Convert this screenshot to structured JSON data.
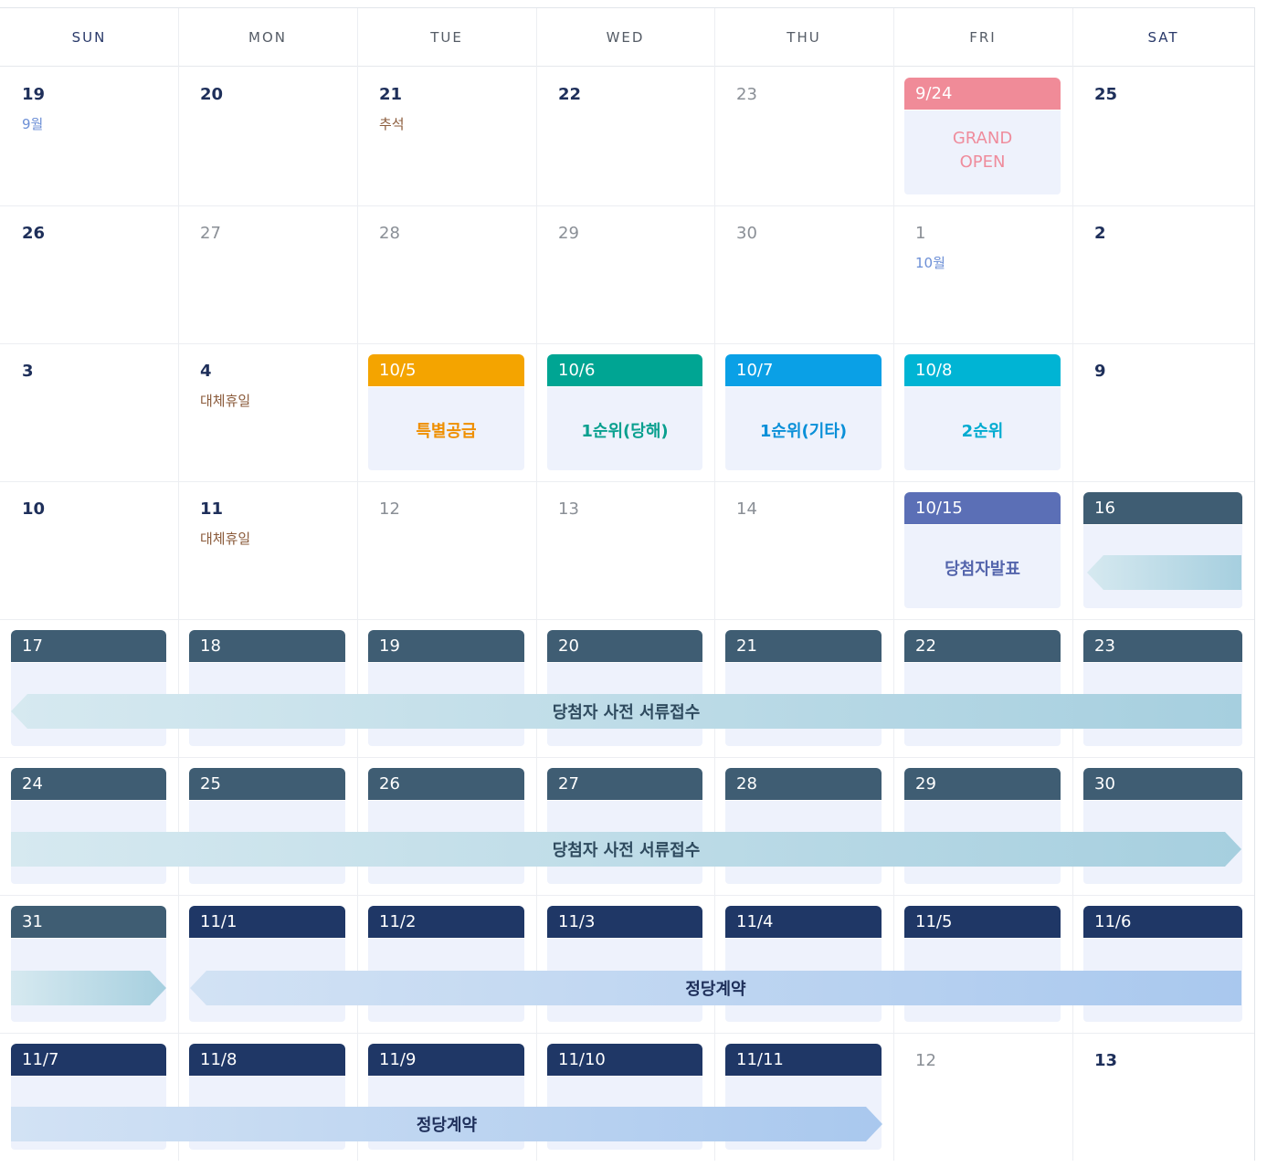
{
  "weekdays": [
    "SUN",
    "MON",
    "TUE",
    "WED",
    "THU",
    "FRI",
    "SAT"
  ],
  "days": [
    {
      "n": "19",
      "sub": "9월",
      "subc": "blue"
    },
    {
      "n": "20"
    },
    {
      "n": "21",
      "sub": "추석",
      "subc": "brown"
    },
    {
      "n": "22"
    },
    {
      "n": "23",
      "light": true
    },
    {
      "n": "",
      "tab": "9/24",
      "tabc": "#f08b98",
      "text": "GRAND OPEN",
      "tc": "#ef8c9c"
    },
    {
      "n": "25"
    },
    {
      "n": "26"
    },
    {
      "n": "27",
      "light": true
    },
    {
      "n": "28",
      "light": true
    },
    {
      "n": "29",
      "light": true
    },
    {
      "n": "30",
      "light": true
    },
    {
      "n": "1",
      "light": true,
      "sub": "10월",
      "subc": "blue"
    },
    {
      "n": "2"
    },
    {
      "n": "3"
    },
    {
      "n": "4",
      "sub": "대체휴일",
      "subc": "brown"
    },
    {
      "n": "",
      "tab": "10/5",
      "tabc": "#f4a400",
      "text": "특별공급",
      "tc": "#ef8f00"
    },
    {
      "n": "",
      "tab": "10/6",
      "tabc": "#00a593",
      "text": "1순위(당해)",
      "tc": "#0aa08f"
    },
    {
      "n": "",
      "tab": "10/7",
      "tabc": "#0aa0e6",
      "text": "1순위(기타)",
      "tc": "#0a90d8"
    },
    {
      "n": "",
      "tab": "10/8",
      "tabc": "#00b4d4",
      "text": "2순위",
      "tc": "#00abd0"
    },
    {
      "n": "9"
    },
    {
      "n": "10"
    },
    {
      "n": "11",
      "sub": "대체휴일",
      "subc": "brown"
    },
    {
      "n": "12",
      "light": true
    },
    {
      "n": "13",
      "light": true
    },
    {
      "n": "14",
      "light": true
    },
    {
      "n": "",
      "tab": "10/15",
      "tabc": "#5b6fb6",
      "text": "당첨자발표",
      "tc": "#5465ac"
    },
    {
      "n": "",
      "tab": "16",
      "tabc": "#3f5d73"
    },
    {
      "tab": "17",
      "tabc": "#3f5d73"
    },
    {
      "tab": "18",
      "tabc": "#3f5d73"
    },
    {
      "tab": "19",
      "tabc": "#3f5d73"
    },
    {
      "tab": "20",
      "tabc": "#3f5d73"
    },
    {
      "tab": "21",
      "tabc": "#3f5d73"
    },
    {
      "tab": "22",
      "tabc": "#3f5d73"
    },
    {
      "tab": "23",
      "tabc": "#3f5d73"
    },
    {
      "tab": "24",
      "tabc": "#3f5d73"
    },
    {
      "tab": "25",
      "tabc": "#3f5d73"
    },
    {
      "tab": "26",
      "tabc": "#3f5d73"
    },
    {
      "tab": "27",
      "tabc": "#3f5d73"
    },
    {
      "tab": "28",
      "tabc": "#3f5d73"
    },
    {
      "tab": "29",
      "tabc": "#3f5d73"
    },
    {
      "tab": "30",
      "tabc": "#3f5d73"
    },
    {
      "tab": "31",
      "tabc": "#3f5d73"
    },
    {
      "tab": "11/1",
      "tabc": "#1f3766"
    },
    {
      "tab": "11/2",
      "tabc": "#1f3766"
    },
    {
      "tab": "11/3",
      "tabc": "#1f3766"
    },
    {
      "tab": "11/4",
      "tabc": "#1f3766"
    },
    {
      "tab": "11/5",
      "tabc": "#1f3766"
    },
    {
      "tab": "11/6",
      "tabc": "#1f3766"
    },
    {
      "tab": "11/7",
      "tabc": "#1f3766"
    },
    {
      "tab": "11/8",
      "tabc": "#1f3766"
    },
    {
      "tab": "11/9",
      "tabc": "#1f3766"
    },
    {
      "tab": "11/10",
      "tabc": "#1f3766"
    },
    {
      "tab": "11/11",
      "tabc": "#1f3766"
    },
    {
      "n": "12",
      "light": true
    },
    {
      "n": "13"
    }
  ],
  "bands": {
    "docs_label": "당첨자 사전 서류접수",
    "contract_label": "정당계약"
  }
}
